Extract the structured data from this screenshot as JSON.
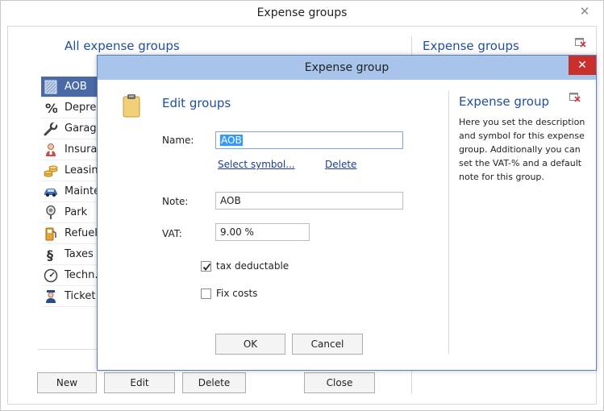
{
  "window": {
    "title": "Expense groups",
    "close_glyph": "✕"
  },
  "left_panel": {
    "heading": "All expense groups"
  },
  "right_panel": {
    "heading": "Expense groups"
  },
  "expense_list": {
    "items": [
      {
        "label": "AOB",
        "icon": "aob-pattern-icon",
        "selected": true
      },
      {
        "label": "Depreciation",
        "icon": "percent-icon"
      },
      {
        "label": "Garage",
        "icon": "wrench-icon"
      },
      {
        "label": "Insurance",
        "icon": "insurance-person-icon"
      },
      {
        "label": "Leasing",
        "icon": "coins-icon"
      },
      {
        "label": "Maintenance",
        "icon": "car-icon"
      },
      {
        "label": "Park",
        "icon": "parking-meter-icon"
      },
      {
        "label": "Refuel",
        "icon": "fuel-pump-icon"
      },
      {
        "label": "Taxes",
        "icon": "paragraph-sign-icon"
      },
      {
        "label": "Techn.control",
        "icon": "gauge-icon"
      },
      {
        "label": "Ticket",
        "icon": "police-officer-icon"
      }
    ]
  },
  "bottom_buttons": {
    "new": "New",
    "edit": "Edit",
    "delete": "Delete",
    "close": "Close"
  },
  "dialog": {
    "title": "Expense group",
    "close_glyph": "✕",
    "heading": "Edit groups",
    "name_label": "Name:",
    "name_value": "AOB",
    "select_symbol_link": "Select symbol...",
    "delete_link": "Delete",
    "note_label": "Note:",
    "note_value": "AOB",
    "vat_label": "VAT:",
    "vat_value": "9.00 %",
    "tax_deductable_label": "tax deductable",
    "tax_deductable_checked": true,
    "fix_costs_label": "Fix costs",
    "fix_costs_checked": false,
    "ok_label": "OK",
    "cancel_label": "Cancel",
    "help_title": "Expense group",
    "help_text": "Here you set the description and symbol for this expense group. Additionally you can set the VAT-% and a default note for this group."
  },
  "colors": {
    "accent_blue": "#1f4e9c",
    "selected_row": "#4a6aa5",
    "dialog_titlebar": "#a9c4ea",
    "close_red": "#c9302c"
  }
}
